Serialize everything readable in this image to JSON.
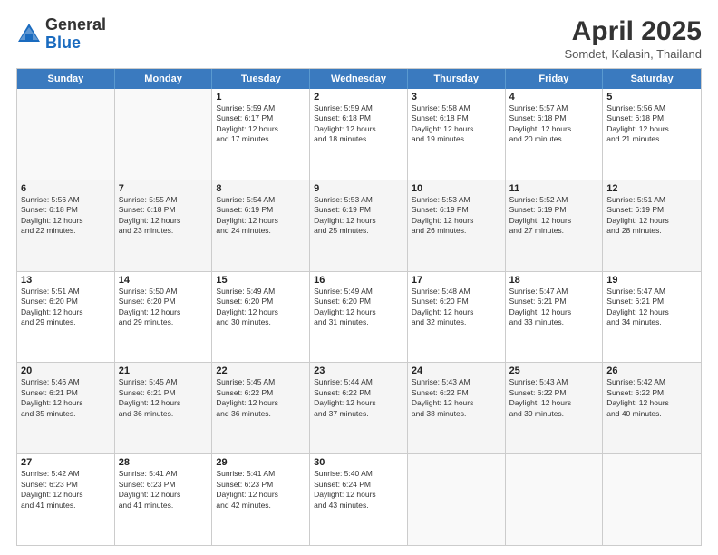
{
  "header": {
    "logo": {
      "line1": "General",
      "line2": "Blue"
    },
    "title": "April 2025",
    "location": "Somdet, Kalasin, Thailand"
  },
  "calendar": {
    "days": [
      "Sunday",
      "Monday",
      "Tuesday",
      "Wednesday",
      "Thursday",
      "Friday",
      "Saturday"
    ],
    "weeks": [
      [
        {
          "day": "",
          "empty": true
        },
        {
          "day": "",
          "empty": true
        },
        {
          "day": "1",
          "sunrise": "5:59 AM",
          "sunset": "6:17 PM",
          "daylight": "12 hours and 17 minutes."
        },
        {
          "day": "2",
          "sunrise": "5:59 AM",
          "sunset": "6:18 PM",
          "daylight": "12 hours and 18 minutes."
        },
        {
          "day": "3",
          "sunrise": "5:58 AM",
          "sunset": "6:18 PM",
          "daylight": "12 hours and 19 minutes."
        },
        {
          "day": "4",
          "sunrise": "5:57 AM",
          "sunset": "6:18 PM",
          "daylight": "12 hours and 20 minutes."
        },
        {
          "day": "5",
          "sunrise": "5:56 AM",
          "sunset": "6:18 PM",
          "daylight": "12 hours and 21 minutes."
        }
      ],
      [
        {
          "day": "6",
          "sunrise": "5:56 AM",
          "sunset": "6:18 PM",
          "daylight": "12 hours and 22 minutes."
        },
        {
          "day": "7",
          "sunrise": "5:55 AM",
          "sunset": "6:18 PM",
          "daylight": "12 hours and 23 minutes."
        },
        {
          "day": "8",
          "sunrise": "5:54 AM",
          "sunset": "6:19 PM",
          "daylight": "12 hours and 24 minutes."
        },
        {
          "day": "9",
          "sunrise": "5:53 AM",
          "sunset": "6:19 PM",
          "daylight": "12 hours and 25 minutes."
        },
        {
          "day": "10",
          "sunrise": "5:53 AM",
          "sunset": "6:19 PM",
          "daylight": "12 hours and 26 minutes."
        },
        {
          "day": "11",
          "sunrise": "5:52 AM",
          "sunset": "6:19 PM",
          "daylight": "12 hours and 27 minutes."
        },
        {
          "day": "12",
          "sunrise": "5:51 AM",
          "sunset": "6:19 PM",
          "daylight": "12 hours and 28 minutes."
        }
      ],
      [
        {
          "day": "13",
          "sunrise": "5:51 AM",
          "sunset": "6:20 PM",
          "daylight": "12 hours and 29 minutes."
        },
        {
          "day": "14",
          "sunrise": "5:50 AM",
          "sunset": "6:20 PM",
          "daylight": "12 hours and 29 minutes."
        },
        {
          "day": "15",
          "sunrise": "5:49 AM",
          "sunset": "6:20 PM",
          "daylight": "12 hours and 30 minutes."
        },
        {
          "day": "16",
          "sunrise": "5:49 AM",
          "sunset": "6:20 PM",
          "daylight": "12 hours and 31 minutes."
        },
        {
          "day": "17",
          "sunrise": "5:48 AM",
          "sunset": "6:20 PM",
          "daylight": "12 hours and 32 minutes."
        },
        {
          "day": "18",
          "sunrise": "5:47 AM",
          "sunset": "6:21 PM",
          "daylight": "12 hours and 33 minutes."
        },
        {
          "day": "19",
          "sunrise": "5:47 AM",
          "sunset": "6:21 PM",
          "daylight": "12 hours and 34 minutes."
        }
      ],
      [
        {
          "day": "20",
          "sunrise": "5:46 AM",
          "sunset": "6:21 PM",
          "daylight": "12 hours and 35 minutes."
        },
        {
          "day": "21",
          "sunrise": "5:45 AM",
          "sunset": "6:21 PM",
          "daylight": "12 hours and 36 minutes."
        },
        {
          "day": "22",
          "sunrise": "5:45 AM",
          "sunset": "6:22 PM",
          "daylight": "12 hours and 36 minutes."
        },
        {
          "day": "23",
          "sunrise": "5:44 AM",
          "sunset": "6:22 PM",
          "daylight": "12 hours and 37 minutes."
        },
        {
          "day": "24",
          "sunrise": "5:43 AM",
          "sunset": "6:22 PM",
          "daylight": "12 hours and 38 minutes."
        },
        {
          "day": "25",
          "sunrise": "5:43 AM",
          "sunset": "6:22 PM",
          "daylight": "12 hours and 39 minutes."
        },
        {
          "day": "26",
          "sunrise": "5:42 AM",
          "sunset": "6:22 PM",
          "daylight": "12 hours and 40 minutes."
        }
      ],
      [
        {
          "day": "27",
          "sunrise": "5:42 AM",
          "sunset": "6:23 PM",
          "daylight": "12 hours and 41 minutes."
        },
        {
          "day": "28",
          "sunrise": "5:41 AM",
          "sunset": "6:23 PM",
          "daylight": "12 hours and 41 minutes."
        },
        {
          "day": "29",
          "sunrise": "5:41 AM",
          "sunset": "6:23 PM",
          "daylight": "12 hours and 42 minutes."
        },
        {
          "day": "30",
          "sunrise": "5:40 AM",
          "sunset": "6:24 PM",
          "daylight": "12 hours and 43 minutes."
        },
        {
          "day": "",
          "empty": true
        },
        {
          "day": "",
          "empty": true
        },
        {
          "day": "",
          "empty": true
        }
      ]
    ]
  }
}
